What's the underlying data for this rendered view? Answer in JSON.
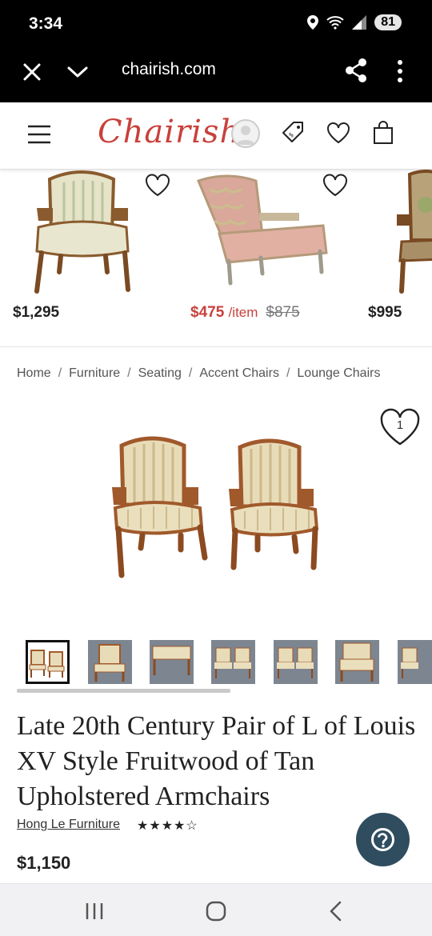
{
  "status_bar": {
    "time": "3:34",
    "battery": "81"
  },
  "browser": {
    "url": "chairish.com"
  },
  "header": {
    "logo": "Chairish"
  },
  "recommendations": [
    {
      "price": "$1,295"
    },
    {
      "price": "$475",
      "unit": "/item",
      "original_price": "$875"
    },
    {
      "price": "$995"
    }
  ],
  "breadcrumb": [
    "Home",
    "Furniture",
    "Seating",
    "Accent Chairs",
    "Lounge Chairs"
  ],
  "breadcrumb_separator": "/",
  "product": {
    "favorite_count": "1",
    "title": "Late 20th Century Pair of L of Louis XV Style Fruitwood of Tan Upholstered Armchairs",
    "seller": "Hong Le Furniture",
    "rating_stars": "★★★★☆",
    "rating": 4,
    "price": "$1,150",
    "thumbnail_count": 7,
    "selected_thumbnail": 1
  },
  "help_icon": "question-mark-icon",
  "colors": {
    "brand": "#c8413b",
    "help_button": "#2f4d5f"
  }
}
